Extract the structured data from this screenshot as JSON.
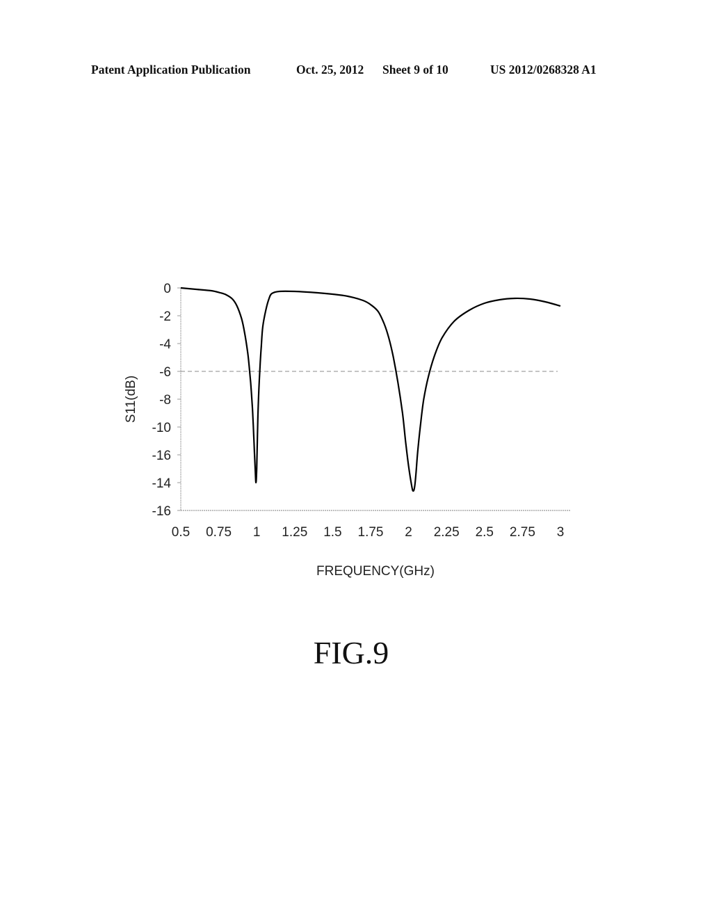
{
  "header": {
    "publication": "Patent Application Publication",
    "date": "Oct. 25, 2012",
    "sheet": "Sheet 9 of 10",
    "number": "US 2012/0268328 A1"
  },
  "figure_label": "FIG.9",
  "chart_data": {
    "type": "line",
    "title": "",
    "xlabel": "FREQUENCY(GHz)",
    "ylabel": "S11(dB)",
    "xlim": [
      0.5,
      3
    ],
    "ylim": [
      -16,
      0
    ],
    "x_ticks": [
      0.5,
      0.75,
      1,
      1.25,
      1.5,
      1.75,
      2,
      2.25,
      2.5,
      2.75,
      3
    ],
    "x_tick_labels": [
      "0.5",
      "0.75",
      "1",
      "1.25",
      "1.5",
      "1.75",
      "2",
      "2.25",
      "2.5",
      "2.75",
      "3"
    ],
    "y_ticks": [
      0,
      -2,
      -4,
      -6,
      -8,
      -10,
      -12,
      -14,
      -16
    ],
    "y_tick_labels": [
      "0",
      "-2",
      "-4",
      "-6",
      "-8",
      "-10",
      "-16",
      "-14",
      "-16"
    ],
    "grid": false,
    "reference_line": {
      "y": -6,
      "style": "dashed",
      "color": "#888888"
    },
    "series": [
      {
        "name": "S11",
        "color": "#000000",
        "x": [
          0.5,
          0.6,
          0.7,
          0.76,
          0.8,
          0.84,
          0.87,
          0.9,
          0.92,
          0.94,
          0.95,
          0.96,
          0.97,
          0.975,
          0.98,
          0.985,
          0.99,
          0.995,
          1.0,
          1.005,
          1.01,
          1.02,
          1.03,
          1.04,
          1.06,
          1.08,
          1.1,
          1.15,
          1.25,
          1.4,
          1.5,
          1.6,
          1.7,
          1.75,
          1.8,
          1.84,
          1.87,
          1.9,
          1.93,
          1.96,
          1.98,
          2.0,
          2.02,
          2.03,
          2.04,
          2.05,
          2.06,
          2.08,
          2.1,
          2.13,
          2.17,
          2.22,
          2.3,
          2.4,
          2.5,
          2.6,
          2.7,
          2.8,
          2.9,
          3.0
        ],
        "y": [
          0,
          -0.1,
          -0.2,
          -0.35,
          -0.5,
          -0.8,
          -1.3,
          -2.2,
          -3.2,
          -4.6,
          -5.6,
          -6.8,
          -8.3,
          -9.3,
          -10.5,
          -11.8,
          -13.0,
          -14.0,
          -13.0,
          -10.5,
          -8.5,
          -6.0,
          -4.2,
          -2.8,
          -1.6,
          -0.8,
          -0.4,
          -0.25,
          -0.25,
          -0.35,
          -0.45,
          -0.6,
          -0.9,
          -1.2,
          -1.7,
          -2.6,
          -3.6,
          -5.0,
          -6.8,
          -9.0,
          -11.0,
          -12.8,
          -14.2,
          -14.6,
          -14.3,
          -13.2,
          -11.8,
          -9.7,
          -8.0,
          -6.4,
          -4.9,
          -3.6,
          -2.4,
          -1.6,
          -1.1,
          -0.85,
          -0.75,
          -0.8,
          -1.0,
          -1.3
        ]
      }
    ]
  }
}
